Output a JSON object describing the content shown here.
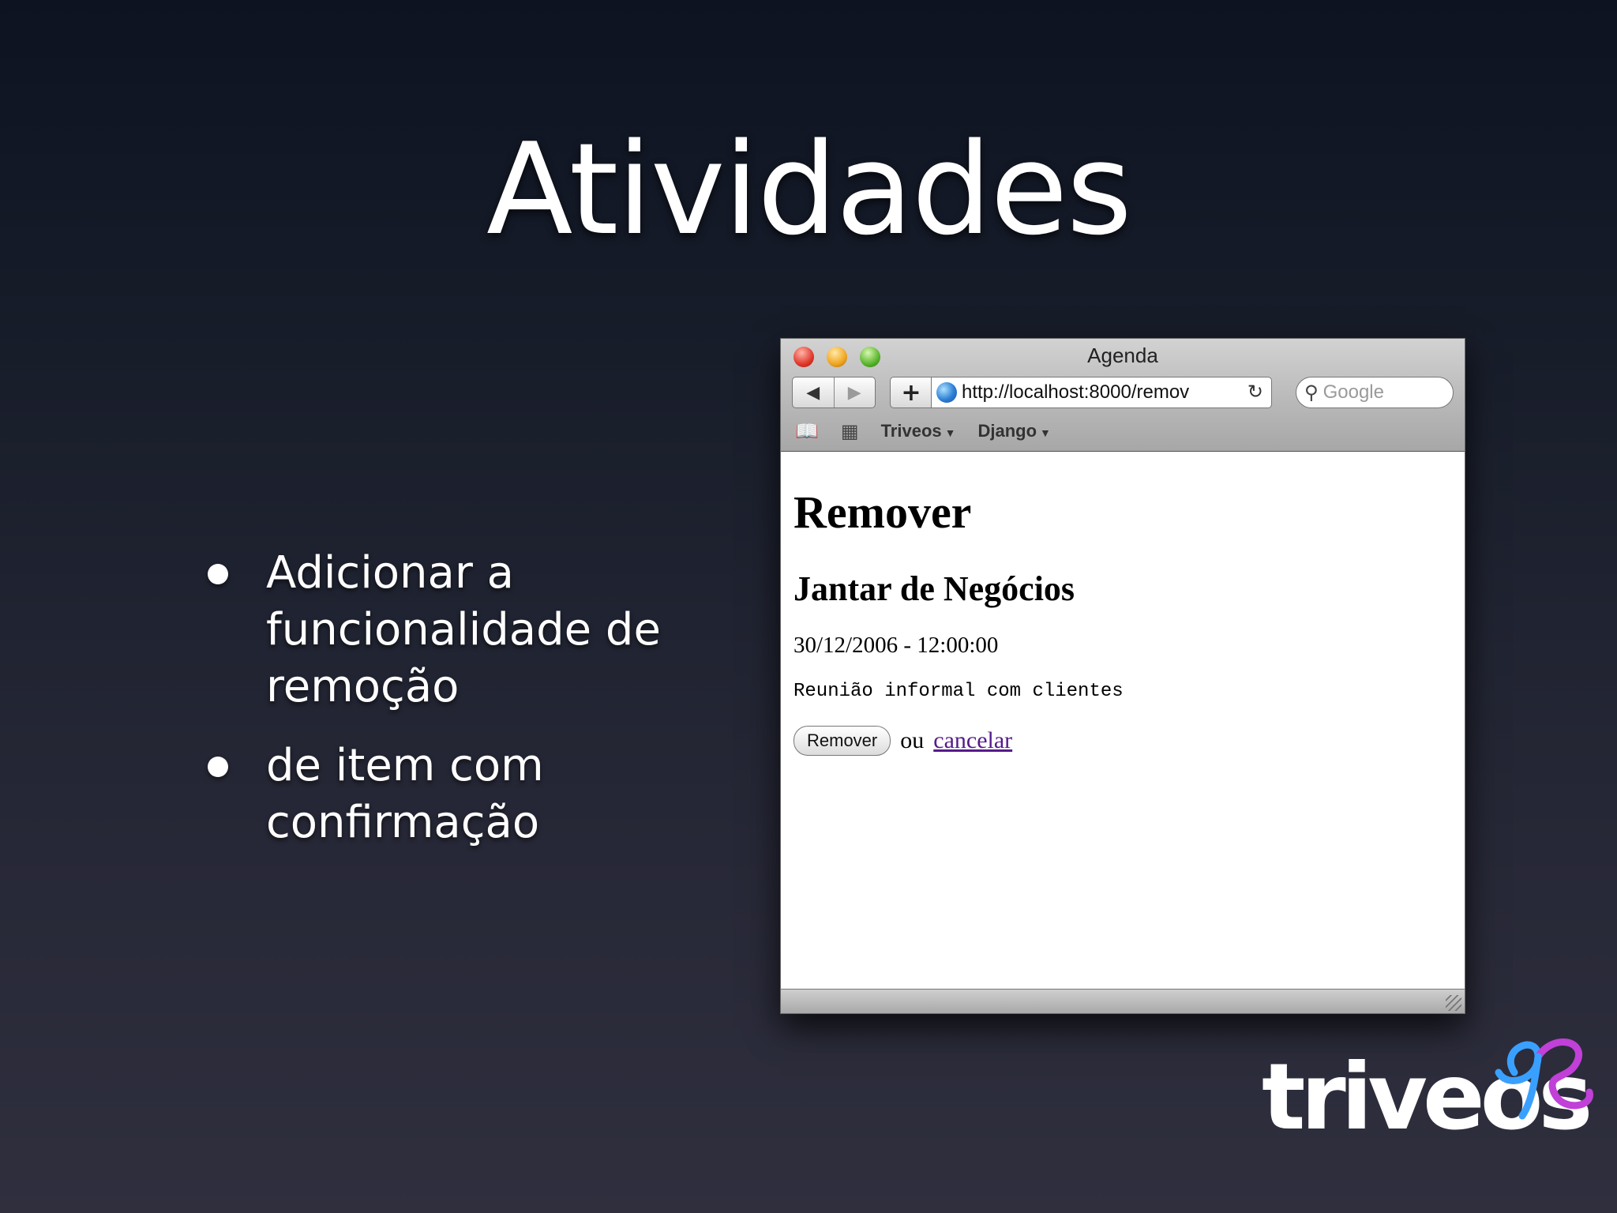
{
  "slide": {
    "title": "Atividades",
    "bullets": [
      "Adicionar a funcionalidade de remoção",
      "de item com confirmação"
    ]
  },
  "browser": {
    "window_title": "Agenda",
    "url": "http://localhost:8000/remov",
    "search_placeholder": "Google",
    "bookmarks": [
      "Triveos",
      "Django"
    ],
    "page": {
      "heading": "Remover",
      "event_title": "Jantar de Negócios",
      "datetime": "30/12/2006 - 12:00:00",
      "description": "Reunião informal com clientes",
      "remove_button": "Remover",
      "or_text": "ou",
      "cancel_link": "cancelar"
    }
  },
  "logo": {
    "text": "triveos"
  },
  "colors": {
    "link_visited": "#551a8b",
    "logo_blue": "#3aa0ff",
    "logo_purple": "#c040d8"
  }
}
